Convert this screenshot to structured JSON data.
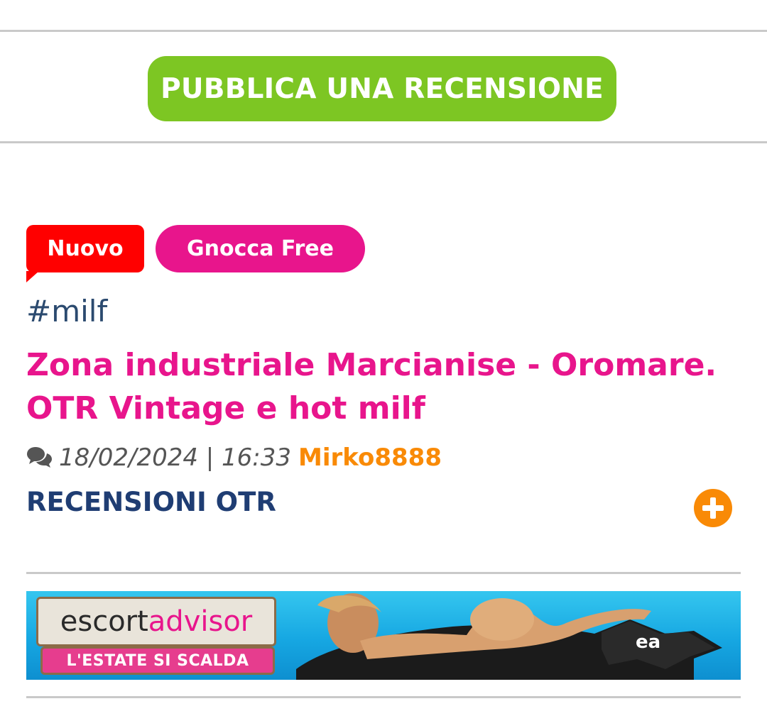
{
  "header": {
    "publish_button_label": "PUBBLICA UNA RECENSIONE"
  },
  "post": {
    "badges": {
      "new_label": "Nuovo",
      "free_label": "Gnocca Free"
    },
    "hashtag": "#milf",
    "title": "Zona industriale Marcianise - Oromare. OTR Vintage e hot milf",
    "date_time": "18/02/2024 | 16:33",
    "author": "Mirko8888",
    "category": "RECENSIONI OTR"
  },
  "ad": {
    "brand_part1": "escort",
    "brand_part2": "advisor",
    "slogan": "L'ESTATE SI SCALDA",
    "logo_mark": "ea"
  },
  "colors": {
    "publish_button": "#7dc623",
    "badge_new": "#ff0000",
    "badge_free": "#e8158c",
    "title": "#e8158c",
    "author": "#f98a06",
    "category": "#1f3d73",
    "plus_button": "#f98a06"
  },
  "icons": {
    "comment": "comment-icon",
    "expand": "plus-circle-icon"
  }
}
